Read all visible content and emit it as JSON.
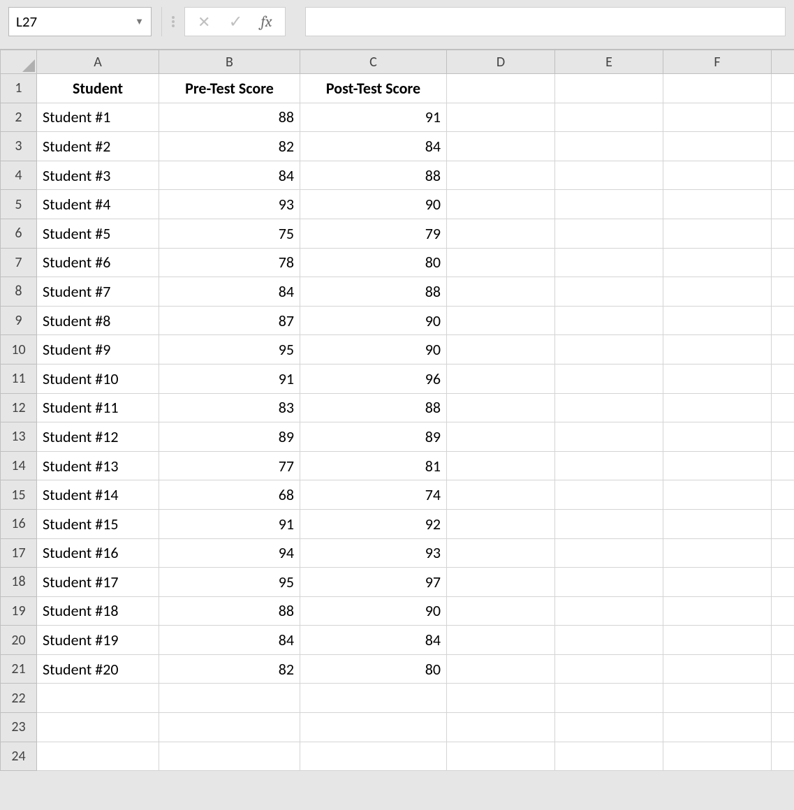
{
  "formula_bar": {
    "name_box_value": "L27",
    "fx_label": "fx",
    "formula_value": ""
  },
  "columns": [
    "A",
    "B",
    "C",
    "D",
    "E",
    "F"
  ],
  "row_numbers": [
    1,
    2,
    3,
    4,
    5,
    6,
    7,
    8,
    9,
    10,
    11,
    12,
    13,
    14,
    15,
    16,
    17,
    18,
    19,
    20,
    21,
    22,
    23,
    24
  ],
  "headers": {
    "A": "Student",
    "B": "Pre-Test Score",
    "C": "Post-Test Score"
  },
  "chart_data": {
    "type": "table",
    "columns": [
      "Student",
      "Pre-Test Score",
      "Post-Test Score"
    ],
    "rows": [
      {
        "Student": "Student #1",
        "Pre-Test Score": 88,
        "Post-Test Score": 91
      },
      {
        "Student": "Student #2",
        "Pre-Test Score": 82,
        "Post-Test Score": 84
      },
      {
        "Student": "Student #3",
        "Pre-Test Score": 84,
        "Post-Test Score": 88
      },
      {
        "Student": "Student #4",
        "Pre-Test Score": 93,
        "Post-Test Score": 90
      },
      {
        "Student": "Student #5",
        "Pre-Test Score": 75,
        "Post-Test Score": 79
      },
      {
        "Student": "Student #6",
        "Pre-Test Score": 78,
        "Post-Test Score": 80
      },
      {
        "Student": "Student #7",
        "Pre-Test Score": 84,
        "Post-Test Score": 88
      },
      {
        "Student": "Student #8",
        "Pre-Test Score": 87,
        "Post-Test Score": 90
      },
      {
        "Student": "Student #9",
        "Pre-Test Score": 95,
        "Post-Test Score": 90
      },
      {
        "Student": "Student #10",
        "Pre-Test Score": 91,
        "Post-Test Score": 96
      },
      {
        "Student": "Student #11",
        "Pre-Test Score": 83,
        "Post-Test Score": 88
      },
      {
        "Student": "Student #12",
        "Pre-Test Score": 89,
        "Post-Test Score": 89
      },
      {
        "Student": "Student #13",
        "Pre-Test Score": 77,
        "Post-Test Score": 81
      },
      {
        "Student": "Student #14",
        "Pre-Test Score": 68,
        "Post-Test Score": 74
      },
      {
        "Student": "Student #15",
        "Pre-Test Score": 91,
        "Post-Test Score": 92
      },
      {
        "Student": "Student #16",
        "Pre-Test Score": 94,
        "Post-Test Score": 93
      },
      {
        "Student": "Student #17",
        "Pre-Test Score": 95,
        "Post-Test Score": 97
      },
      {
        "Student": "Student #18",
        "Pre-Test Score": 88,
        "Post-Test Score": 90
      },
      {
        "Student": "Student #19",
        "Pre-Test Score": 84,
        "Post-Test Score": 84
      },
      {
        "Student": "Student #20",
        "Pre-Test Score": 82,
        "Post-Test Score": 80
      }
    ]
  }
}
